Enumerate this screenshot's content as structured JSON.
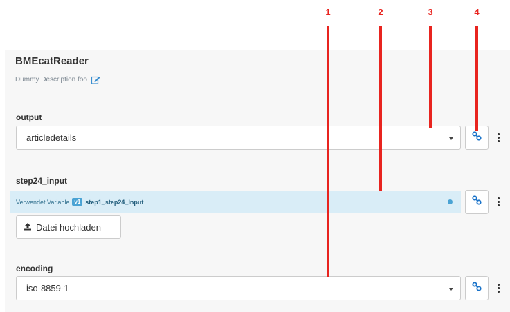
{
  "component": {
    "title": "BMEcatReader",
    "description": "Dummy Description foo"
  },
  "fields": {
    "output": {
      "label": "output",
      "value": "articledetails"
    },
    "step24_input": {
      "label": "step24_input",
      "variable_prefix": "Verwendet Variable",
      "variable_badge": "v1",
      "variable_name": "step1_step24_Input",
      "upload_label": "Datei hochladen"
    },
    "encoding": {
      "label": "encoding",
      "value": "iso-8859-1"
    }
  },
  "markers": [
    "1",
    "2",
    "3",
    "4"
  ],
  "colors": {
    "marker": "#e8241f",
    "link_icon": "#1a73c9",
    "variable_bar": "#d9edf7",
    "badge": "#4aa3d4"
  },
  "icons": {
    "edit": "edit-icon",
    "link": "link-icon",
    "more": "vertical-dots-icon",
    "upload": "upload-icon",
    "clear": "clear-variable-icon"
  }
}
